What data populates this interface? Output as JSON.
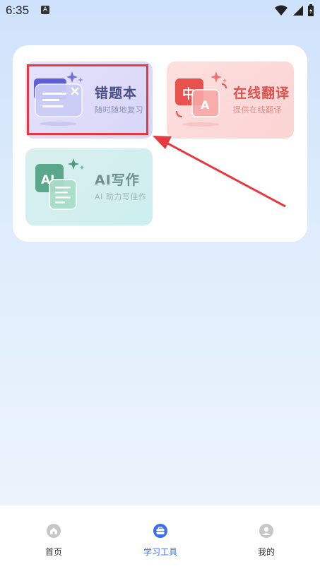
{
  "status_bar": {
    "time": "6:35",
    "app_icon": "A"
  },
  "tools": {
    "wrong_book": {
      "title": "错题本",
      "subtitle": "随时随地复习"
    },
    "translate": {
      "title": "在线翻译",
      "subtitle": "提供在线翻译",
      "icon_zh": "中",
      "icon_en": "A"
    },
    "ai_writing": {
      "title": "AI写作",
      "subtitle": "AI 助力写佳作",
      "icon_text": "AI"
    }
  },
  "bottom_nav": {
    "items": [
      {
        "label": "首页",
        "icon": "home-icon"
      },
      {
        "label": "学习工具",
        "icon": "toolbox-icon",
        "active": true
      },
      {
        "label": "我的",
        "icon": "user-icon"
      }
    ]
  },
  "colors": {
    "accent": "#3b6ef5",
    "highlight": "#e5393f",
    "translate_title": "#d9534f"
  }
}
